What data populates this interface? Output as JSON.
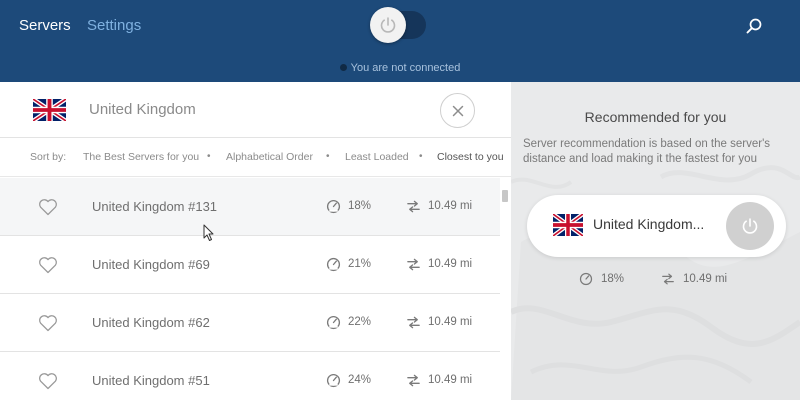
{
  "header": {
    "tabs": [
      {
        "label": "Servers"
      },
      {
        "label": "Settings"
      }
    ],
    "status": "You are not connected"
  },
  "search": {
    "country": "United Kingdom"
  },
  "sort": {
    "label": "Sort by:",
    "options": [
      {
        "label": "The Best Servers for you"
      },
      {
        "label": "Alphabetical Order"
      },
      {
        "label": "Least Loaded"
      },
      {
        "label": "Closest to you"
      }
    ],
    "active": "Closest to you"
  },
  "servers": [
    {
      "name": "United Kingdom #131",
      "load": "18%",
      "distance": "10.49 mi"
    },
    {
      "name": "United Kingdom #69",
      "load": "21%",
      "distance": "10.49 mi"
    },
    {
      "name": "United Kingdom #62",
      "load": "22%",
      "distance": "10.49 mi"
    },
    {
      "name": "United Kingdom #51",
      "load": "24%",
      "distance": "10.49 mi"
    }
  ],
  "recommended": {
    "title": "Recommended for you",
    "description": "Server recommendation is based on the server's distance and load making it the fastest for you",
    "server_name": "United Kingdom...",
    "load": "18%",
    "distance": "10.49 mi"
  },
  "colors": {
    "header_bg": "#1d4a7a",
    "active_tab": "#ffffff",
    "inactive_tab": "#7fb1e0",
    "right_panel_bg": "#e9eaeb"
  },
  "icons": {
    "power": "power-icon",
    "search": "search-icon",
    "clear": "close-icon",
    "favorite": "heart-icon",
    "load": "gauge-icon",
    "distance": "distance-arrows-icon",
    "flag": "uk-flag-icon"
  }
}
